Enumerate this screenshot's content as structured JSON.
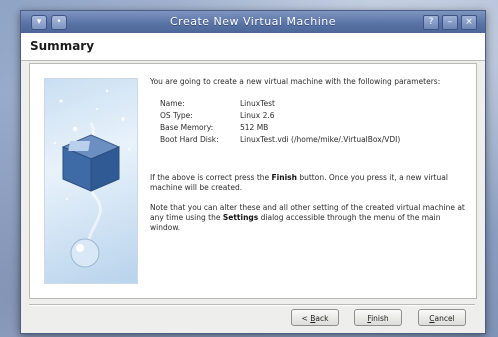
{
  "window": {
    "title": "Create New Virtual Machine"
  },
  "header": {
    "title": "Summary"
  },
  "body": {
    "intro": "You are going to create a new virtual machine with the following parameters:",
    "params": [
      {
        "label": "Name:",
        "value": "LinuxTest"
      },
      {
        "label": "OS Type:",
        "value": "Linux 2.6"
      },
      {
        "label": "Base Memory:",
        "value": "512 MB"
      },
      {
        "label": "Boot Hard Disk:",
        "value": "LinuxTest.vdi (/home/mike/.VirtualBox/VDI)"
      }
    ],
    "finish_note": {
      "before": "If the above is correct press the ",
      "bold": "Finish",
      "after": " button. Once you press it, a new virtual machine will be created."
    },
    "settings_note": {
      "before": "Note that you can alter these and all other setting of the created virtual machine at any time using the ",
      "bold": "Settings",
      "after": " dialog accessible through the menu of the main window."
    }
  },
  "buttons": {
    "back": {
      "prefix": "< ",
      "mnemonic": "B",
      "rest": "ack"
    },
    "finish": {
      "mnemonic": "F",
      "rest": "inish"
    },
    "cancel": {
      "mnemonic": "C",
      "rest": "ancel"
    }
  }
}
